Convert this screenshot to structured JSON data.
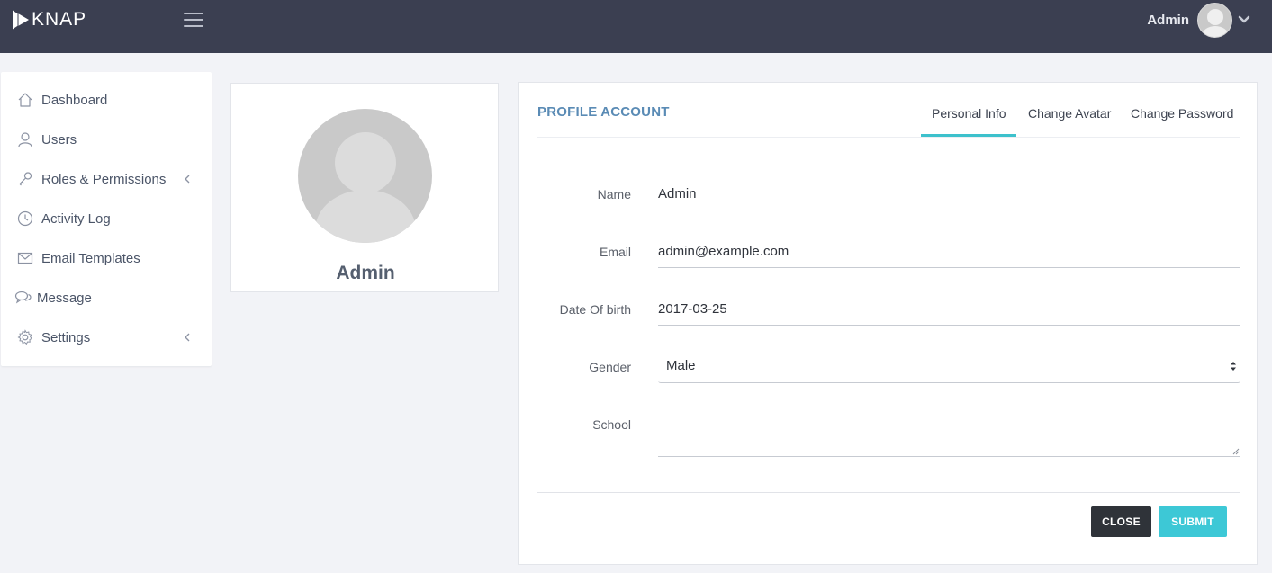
{
  "topbar": {
    "brand": "KNAP",
    "user_name": "Admin"
  },
  "sidebar": {
    "items": [
      {
        "label": "Dashboard",
        "icon": "home-icon"
      },
      {
        "label": "Users",
        "icon": "user-icon"
      },
      {
        "label": "Roles & Permissions",
        "icon": "key-icon",
        "has_submenu": true
      },
      {
        "label": "Activity Log",
        "icon": "clock-icon"
      },
      {
        "label": "Email Templates",
        "icon": "envelope-icon"
      },
      {
        "label": "Message",
        "icon": "chat-icon"
      },
      {
        "label": "Settings",
        "icon": "gear-icon",
        "has_submenu": true
      }
    ]
  },
  "profile": {
    "name": "Admin"
  },
  "form": {
    "title": "PROFILE ACCOUNT",
    "tabs": [
      {
        "label": "Personal Info",
        "active": true
      },
      {
        "label": "Change Avatar",
        "active": false
      },
      {
        "label": "Change Password",
        "active": false
      }
    ],
    "fields": {
      "name": {
        "label": "Name",
        "value": "Admin"
      },
      "email": {
        "label": "Email",
        "value": "admin@example.com"
      },
      "dob": {
        "label": "Date Of birth",
        "value": "2017-03-25"
      },
      "gender": {
        "label": "Gender",
        "value": "Male"
      },
      "school": {
        "label": "School",
        "value": ""
      }
    },
    "buttons": {
      "close": "CLOSE",
      "submit": "SUBMIT"
    }
  },
  "colors": {
    "topbar": "#3b3f51",
    "accent": "#3dc8d6",
    "title": "#5a8bb5",
    "close_button": "#2f3339"
  }
}
